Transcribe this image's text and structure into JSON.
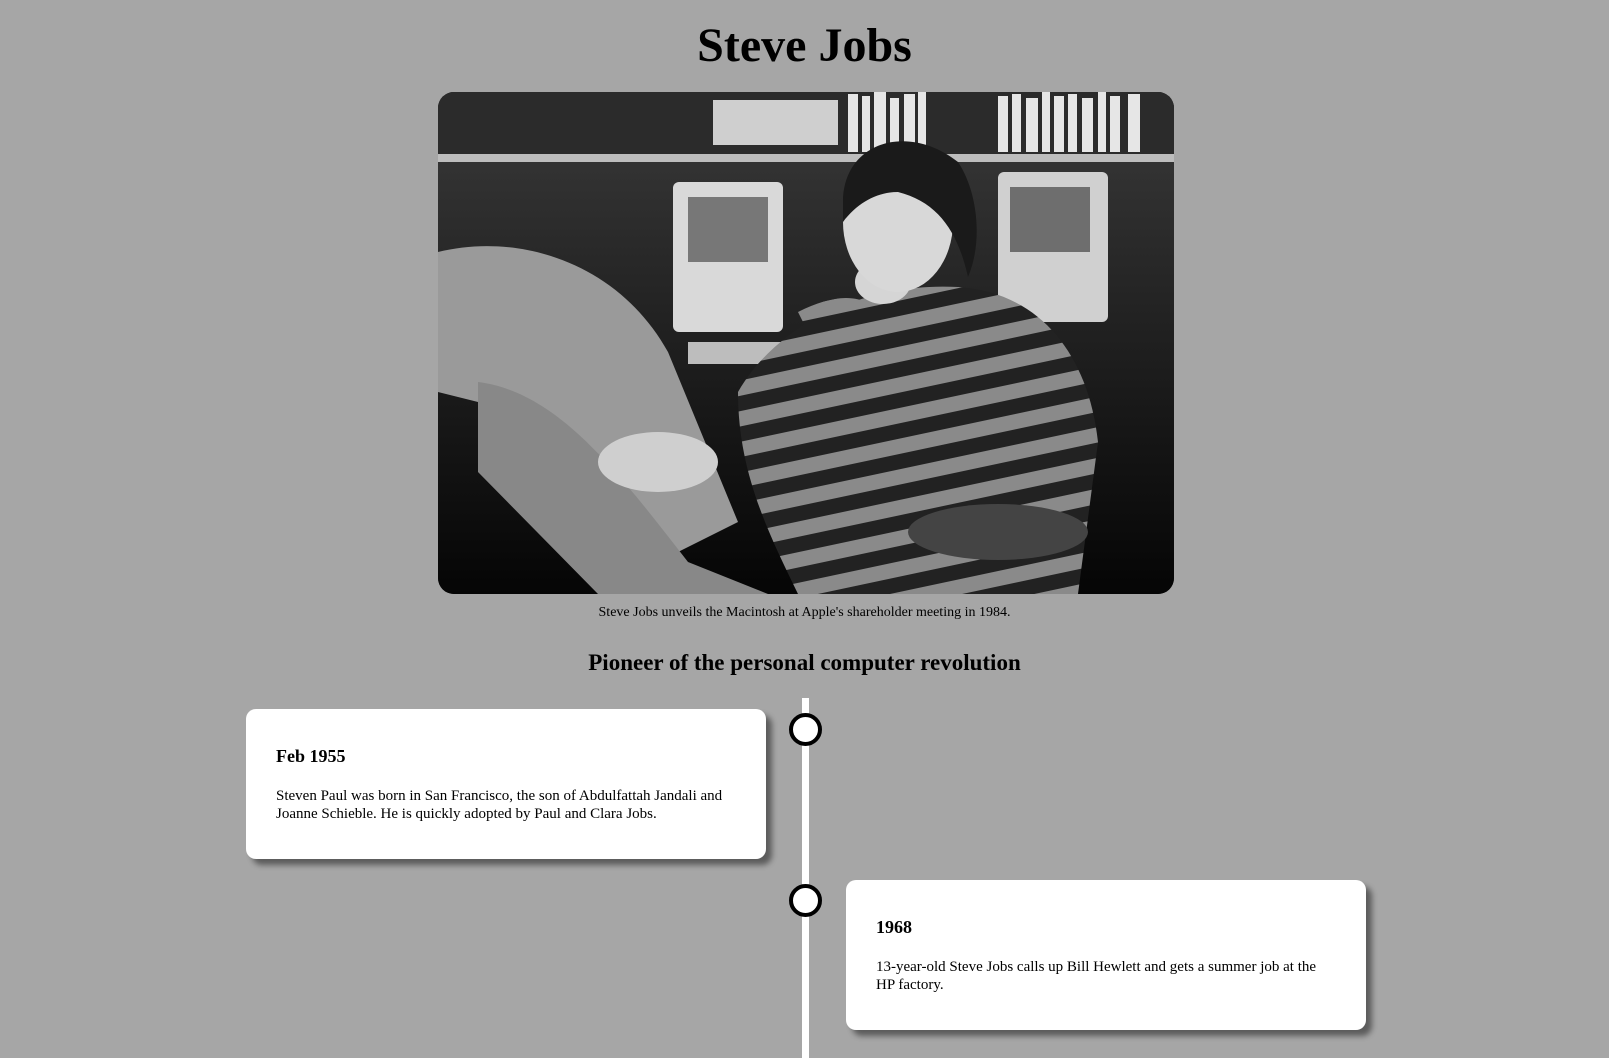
{
  "page": {
    "title": "Steve Jobs",
    "photo_caption": "Steve Jobs unveils the Macintosh at Apple's shareholder meeting in 1984.",
    "subtitle": "Pioneer of the personal computer revolution"
  },
  "timeline": {
    "events": [
      {
        "date": "Feb 1955",
        "text": "Steven Paul was born in San Francisco, the son of Abdulfattah Jandali and Joanne Schieble. He is quickly adopted by Paul and Clara Jobs.",
        "side": "left"
      },
      {
        "date": "1968",
        "text": "13-year-old Steve Jobs calls up Bill Hewlett and gets a summer job at the HP factory.",
        "side": "right"
      }
    ]
  },
  "colors": {
    "background": "#a6a6a6",
    "card": "#ffffff",
    "timeline_line": "#ffffff",
    "dot_border": "#000000"
  }
}
